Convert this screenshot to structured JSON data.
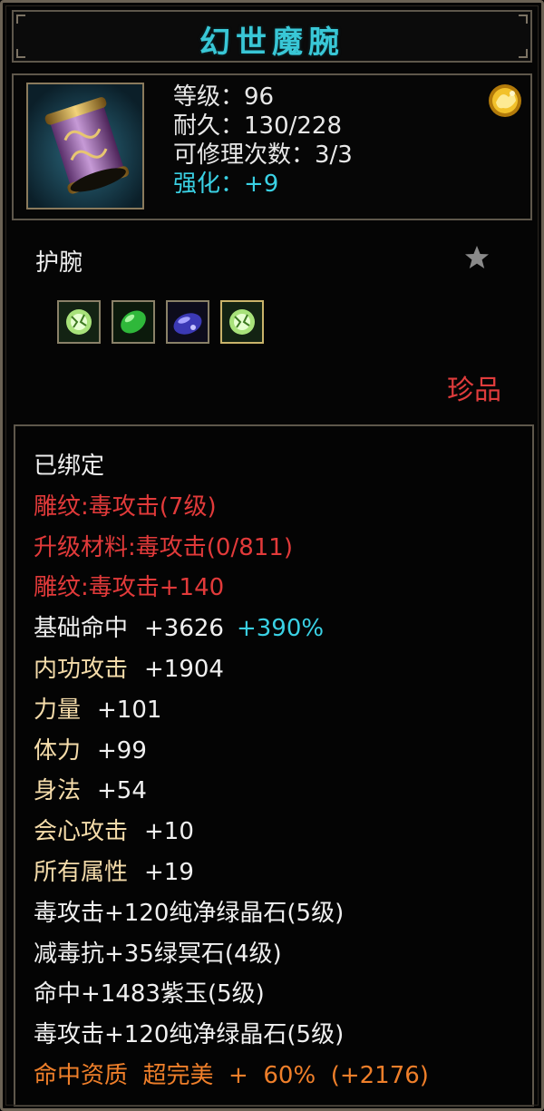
{
  "item": {
    "name": "幻世魔腕",
    "level_label": "等级：96",
    "durability_label": "耐久：130/228",
    "repair_label": "可修理次数：3/3",
    "enhance_label": "强化：+9",
    "slot_type": "护腕",
    "rarity": "珍品",
    "gems": [
      "green-crystal-gem",
      "green-jade-gem",
      "purple-jade-gem",
      "green-crystal-gem"
    ]
  },
  "attributes": {
    "bound": "已绑定",
    "engrave": "雕纹:毒攻击(7级)",
    "upgrade_material": "升级材料:毒攻击(0/811)",
    "engrave_bonus": "雕纹:毒攻击+140",
    "hit": {
      "label": "基础命中",
      "value": "+3626",
      "percent": "+390%"
    },
    "internal_attack": {
      "label": "内功攻击",
      "value": "+1904"
    },
    "strength": {
      "label": "力量",
      "value": "+101"
    },
    "stamina": {
      "label": "体力",
      "value": "+99"
    },
    "agility": {
      "label": "身法",
      "value": "+54"
    },
    "crit_attack": {
      "label": "会心攻击",
      "value": "+10"
    },
    "all_attributes": {
      "label": "所有属性",
      "value": "+19"
    },
    "gem_line_1": "毒攻击+120纯净绿晶石(5级)",
    "gem_line_2": "减毒抗+35绿冥石(4级)",
    "gem_line_3": "命中+1483紫玉(5级)",
    "gem_line_4": "毒攻击+120纯净绿晶石(5级)",
    "aptitude": "命中资质  超完美  +  60%  (+2176)"
  },
  "colors": {
    "title": "#39c7d6",
    "enhance": "#3ad1e4",
    "red_text": "#e23a3a",
    "rarity": "#e03c3c",
    "stat_text": "#f5dcaa",
    "aptitude": "#ef7f2a",
    "border": "#5e574b"
  },
  "icons": {
    "item_icon": "bracer-icon",
    "medal_icon": "gold-badge-icon",
    "favorite_icon": "star-icon"
  }
}
